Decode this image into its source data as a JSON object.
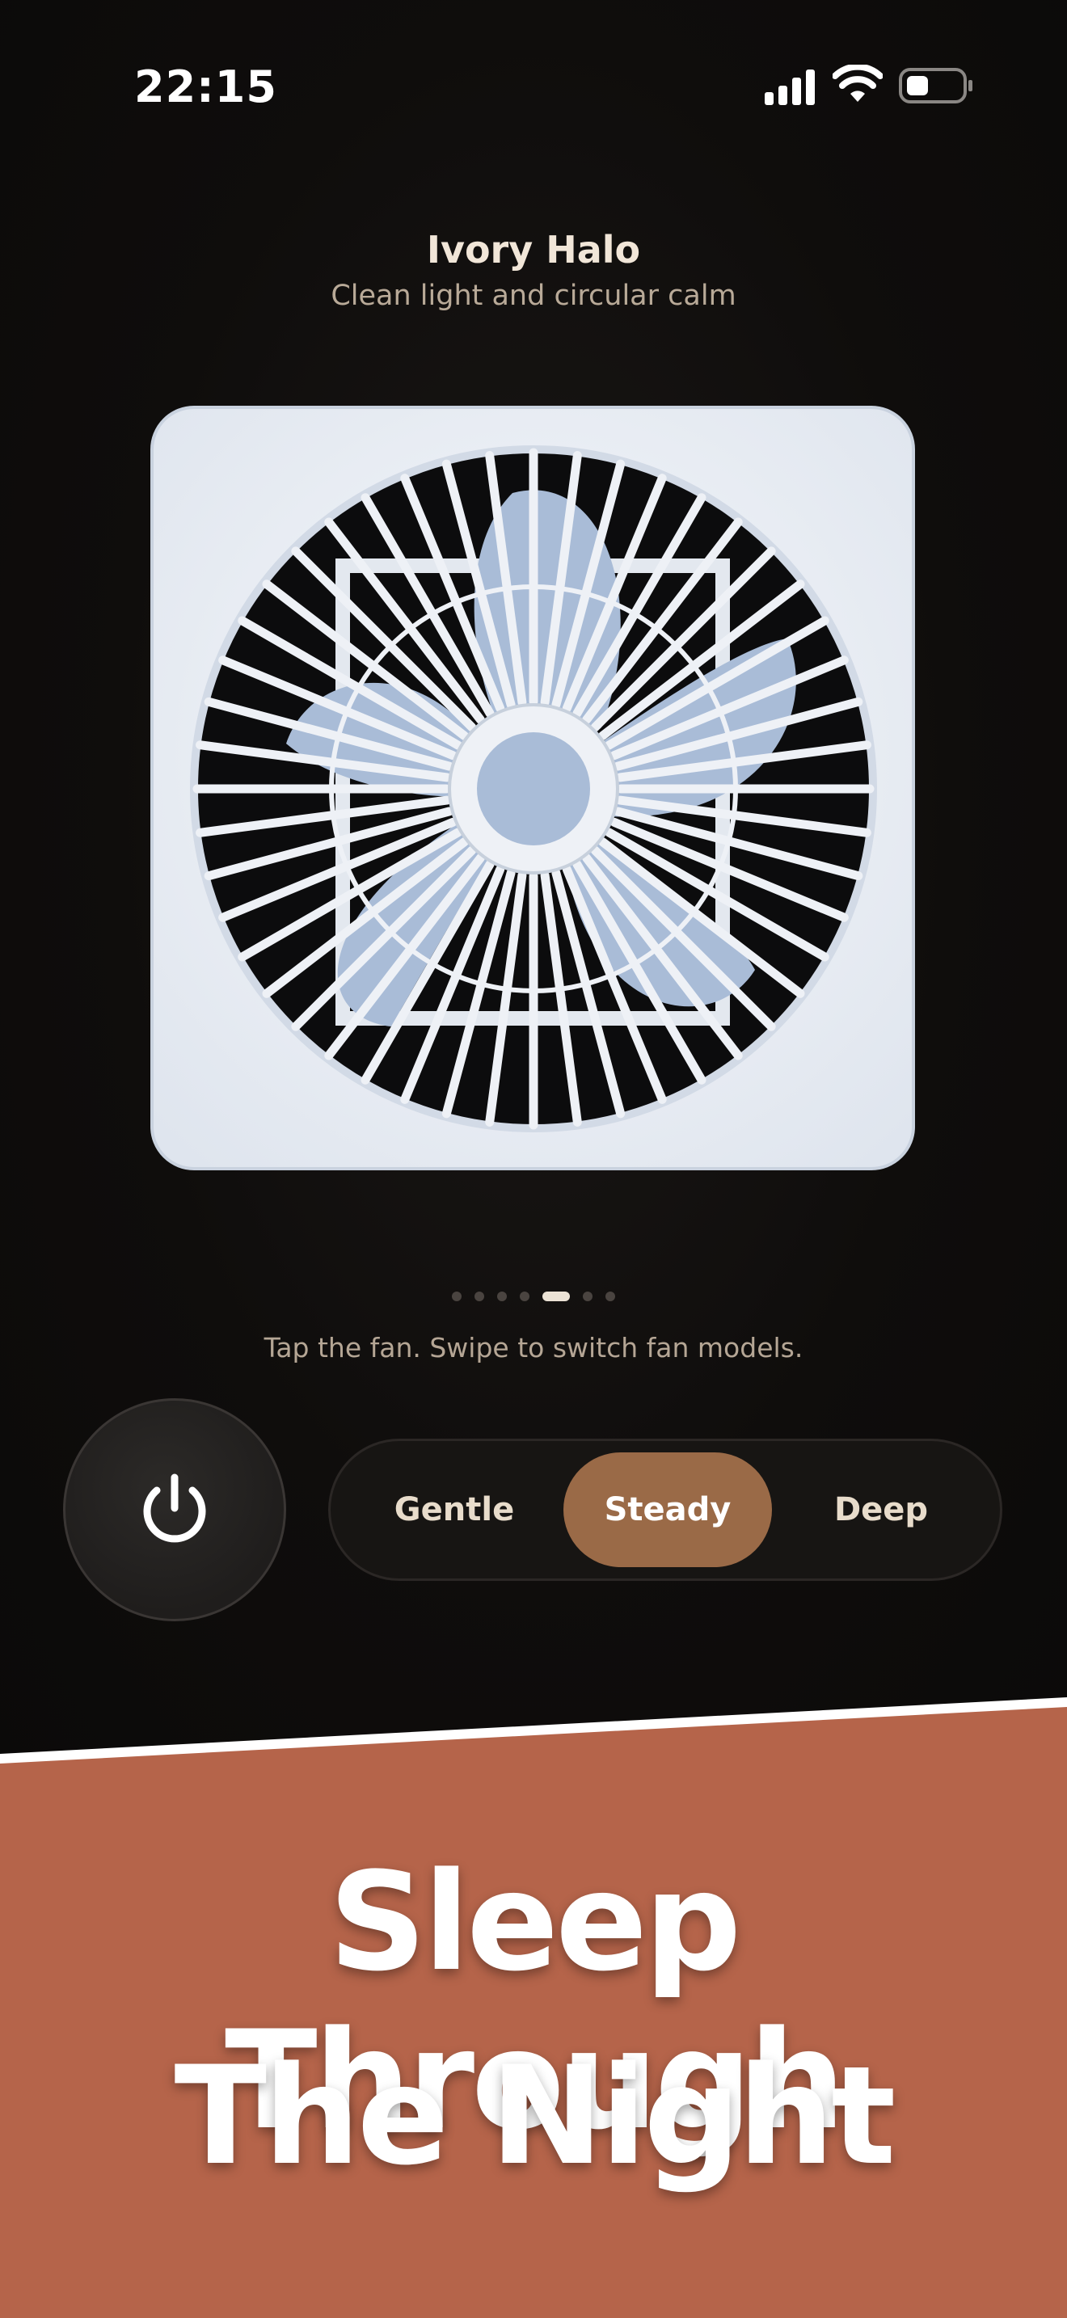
{
  "status_bar": {
    "time": "22:15",
    "icons": [
      "cellular-signal-icon",
      "wifi-icon",
      "battery-icon"
    ]
  },
  "fan": {
    "name": "Ivory Halo",
    "tagline": "Clean light and circular calm",
    "illustration": "box-fan-icon",
    "colors": {
      "frame": "#eef1f6",
      "blades": "#a9bcd7"
    }
  },
  "pager": {
    "count": 7,
    "active_index": 4
  },
  "hint": "Tap the fan. Swipe to switch fan models.",
  "controls": {
    "power_icon": "power-icon",
    "speeds": [
      "Gentle",
      "Steady",
      "Deep"
    ],
    "selected_speed": "Steady",
    "accent_color": "#9a6a47"
  },
  "promo": {
    "line1": "Sleep Through",
    "line2": "The Night",
    "background_color": "#b5644a"
  }
}
